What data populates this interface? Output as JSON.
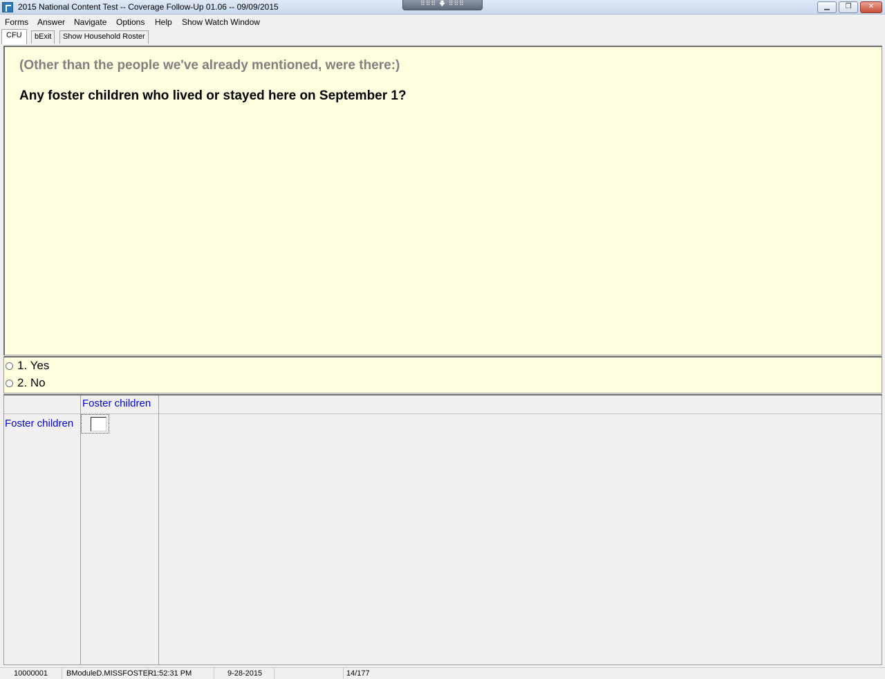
{
  "window": {
    "title": "2015 National Content Test -- Coverage Follow-Up 01.06 -- 09/09/2015",
    "grip_label": "⠿⠿⠿  🡇  ⠿⠿⠿",
    "minimize_label": "▁",
    "maximize_label": "❐",
    "close_label": "✕"
  },
  "menu": [
    "Forms",
    "Answer",
    "Navigate",
    "Options",
    "Help",
    "Show Watch Window"
  ],
  "tabs": [
    {
      "label": "CFU",
      "active": true
    },
    {
      "label": "bExit",
      "active": false
    },
    {
      "label": "Show Household Roster",
      "active": false
    }
  ],
  "question": {
    "preamble": "(Other than the people we've already mentioned, were there:)",
    "text": "Any foster children who lived or stayed here on September 1?"
  },
  "answers": [
    {
      "label": "1. Yes",
      "selected": false
    },
    {
      "label": "2. No",
      "selected": false
    }
  ],
  "grid": {
    "column_header": "Foster children",
    "row_header": "Foster children",
    "cell_value": ""
  },
  "status": {
    "case_id": "10000001",
    "field": "BModuleD.MISSFOSTER",
    "time": "1:52:31 PM",
    "date": "9-28-2015",
    "blank": "",
    "page": "14/177"
  },
  "colors": {
    "panel_background": "#ffffe0",
    "grid_label": "#0000e0",
    "preamble_text": "#808080"
  }
}
